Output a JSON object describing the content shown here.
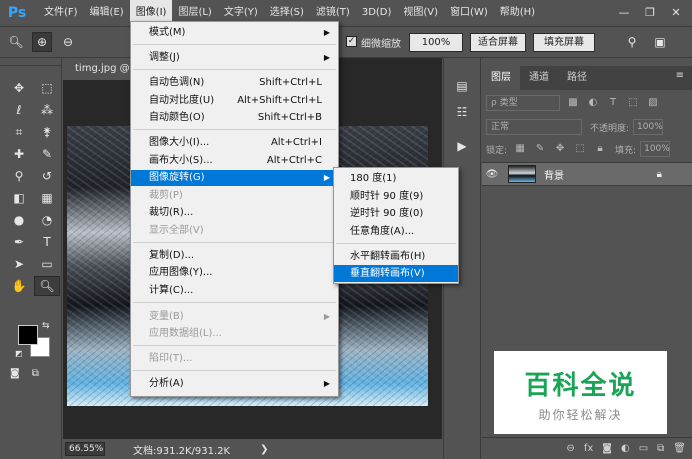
{
  "app": {
    "logo": "Ps"
  },
  "menubar": {
    "items": [
      "文件(F)",
      "编辑(E)",
      "图像(I)",
      "图层(L)",
      "文字(Y)",
      "选择(S)",
      "滤镜(T)",
      "3D(D)",
      "视图(V)",
      "窗口(W)",
      "帮助(H)"
    ],
    "active_index": 2
  },
  "window_controls": {
    "minimize": "—",
    "restore": "❐",
    "close": "✕"
  },
  "optionsbar": {
    "scrubby_zoom_checked": true,
    "scrubby_zoom_label": "细微缩放",
    "btn_100": "100%",
    "btn_fit": "适合屏幕",
    "btn_fill": "填充屏幕"
  },
  "document": {
    "tab_title": "timg.jpg @ 6",
    "zoom": "66.55%",
    "doc_info": "文档:931.2K/931.2K",
    "status_arrow": "❯"
  },
  "image_menu": {
    "items": [
      {
        "label": "模式(M)",
        "shortcut": "",
        "submenu": true,
        "disabled": false
      },
      {
        "label": "调整(J)",
        "shortcut": "",
        "submenu": true,
        "disabled": false
      },
      {
        "label": "自动色调(N)",
        "shortcut": "Shift+Ctrl+L",
        "submenu": false,
        "disabled": false
      },
      {
        "label": "自动对比度(U)",
        "shortcut": "Alt+Shift+Ctrl+L",
        "submenu": false,
        "disabled": false
      },
      {
        "label": "自动颜色(O)",
        "shortcut": "Shift+Ctrl+B",
        "submenu": false,
        "disabled": false
      },
      {
        "label": "图像大小(I)...",
        "shortcut": "Alt+Ctrl+I",
        "submenu": false,
        "disabled": false
      },
      {
        "label": "画布大小(S)...",
        "shortcut": "Alt+Ctrl+C",
        "submenu": false,
        "disabled": false
      },
      {
        "label": "图像旋转(G)",
        "shortcut": "",
        "submenu": true,
        "disabled": false,
        "highlighted": true
      },
      {
        "label": "裁剪(P)",
        "shortcut": "",
        "submenu": false,
        "disabled": true
      },
      {
        "label": "裁切(R)...",
        "shortcut": "",
        "submenu": false,
        "disabled": false
      },
      {
        "label": "显示全部(V)",
        "shortcut": "",
        "submenu": false,
        "disabled": true
      },
      {
        "label": "复制(D)...",
        "shortcut": "",
        "submenu": false,
        "disabled": false
      },
      {
        "label": "应用图像(Y)...",
        "shortcut": "",
        "submenu": false,
        "disabled": false
      },
      {
        "label": "计算(C)...",
        "shortcut": "",
        "submenu": false,
        "disabled": false
      },
      {
        "label": "变量(B)",
        "shortcut": "",
        "submenu": true,
        "disabled": true
      },
      {
        "label": "应用数据组(L)...",
        "shortcut": "",
        "submenu": false,
        "disabled": true
      },
      {
        "label": "陷印(T)...",
        "shortcut": "",
        "submenu": false,
        "disabled": true
      },
      {
        "label": "分析(A)",
        "shortcut": "",
        "submenu": true,
        "disabled": false
      }
    ]
  },
  "rotate_submenu": {
    "items": [
      {
        "label": "180 度(1)",
        "highlighted": false
      },
      {
        "label": "顺时针 90 度(9)",
        "highlighted": false
      },
      {
        "label": "逆时针 90 度(0)",
        "highlighted": false
      },
      {
        "label": "任意角度(A)...",
        "highlighted": false
      },
      {
        "label": "水平翻转画布(H)",
        "highlighted": false
      },
      {
        "label": "垂直翻转画布(V)",
        "highlighted": true
      }
    ]
  },
  "layers_panel": {
    "tabs": [
      "图层",
      "通道",
      "路径"
    ],
    "active_tab": 0,
    "filter_placeholder": "ρ 类型",
    "blend_mode": "正常",
    "opacity_label": "不透明度:",
    "opacity_value": "100%",
    "lock_label": "锁定:",
    "fill_label": "填充:",
    "fill_value": "100%",
    "layer_name": "背景",
    "bottom_icons": [
      "link-icon",
      "fx-icon",
      "mask-icon",
      "adjustment-icon",
      "group-icon",
      "new-layer-icon",
      "trash-icon"
    ]
  },
  "watermark": {
    "big": "百科全说",
    "small": "助你轻松解决"
  },
  "colors": {
    "accent": "#0078d7",
    "brand": "#1aa556"
  }
}
